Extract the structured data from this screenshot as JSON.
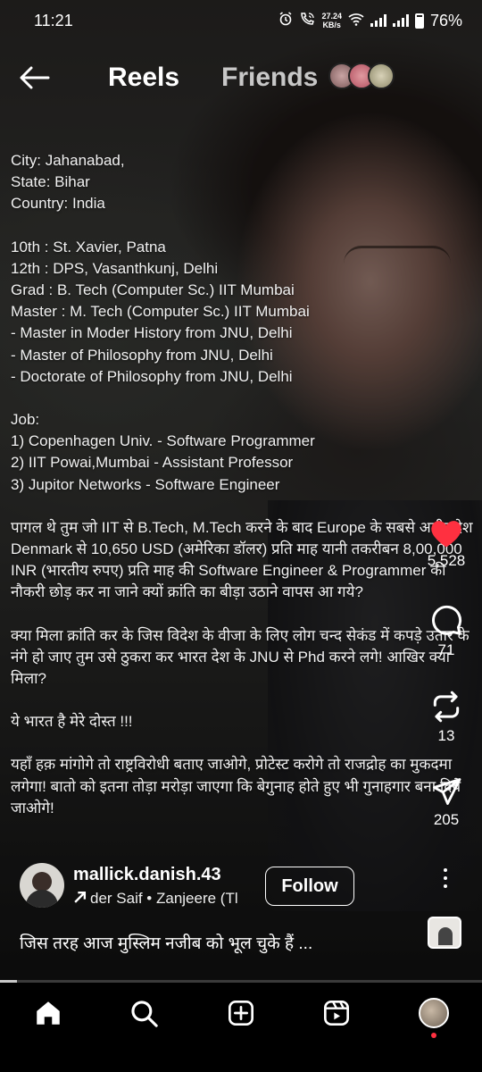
{
  "status_bar": {
    "time": "11:21",
    "net_speed_value": "27.24",
    "net_speed_unit": "KB/s",
    "battery": "76%",
    "icons": [
      "alarm-icon",
      "wifi-call-icon",
      "wifi-icon",
      "signal-icon",
      "signal-icon",
      "battery-icon"
    ]
  },
  "header": {
    "back_icon": "arrow-left-icon",
    "tab_reels": "Reels",
    "tab_friends": "Friends"
  },
  "overlay": {
    "location": [
      "City: Jahanabad,",
      "State: Bihar",
      "Country: India"
    ],
    "education": [
      "10th : St. Xavier, Patna",
      "12th : DPS, Vasanthkunj, Delhi",
      "Grad : B. Tech (Computer Sc.) IIT Mumbai",
      "Master : M. Tech (Computer Sc.) IIT Mumbai",
      "- Master in Moder History from JNU, Delhi",
      "- Master of Philosophy from JNU, Delhi",
      "- Doctorate of Philosophy from JNU, Delhi"
    ],
    "job_title": "Job:",
    "jobs": [
      "1) Copenhagen Univ. - Software Programmer",
      "2) IIT Powai,Mumbai - Assistant Professor",
      "3) Jupitor Networks - Software Engineer"
    ],
    "para1": "पागल थे तुम जो IIT से B.Tech, M.Tech करने के बाद Europe के सबसे अमीर देश Denmark से 10,650 USD (अमेरिका डॉलर) प्रति माह यानी तकरीबन 8,00,000 INR (भारतीय रुपए) प्रति माह की Software Engineer & Programmer की नौकरी छोड़ कर ना जाने क्यों क्रांति का बीड़ा उठाने वापस आ गये?",
    "para2": "क्या मिला क्रांति कर के जिस विदेश के वीजा के लिए लोग चन्द सेकंड में कपड़े उतार के नंगे हो जाए तुम उसे ठुकरा कर भारत देश के JNU से Phd करने लगे! आखिर क्या मिला?",
    "para3": "ये भारत है मेरे दोस्त !!!",
    "para4": "यहाँ हक़ मांगोगे तो राष्ट्रविरोधी बताए जाओगे, प्रोटेस्ट करोगे तो राजद्रोह का मुकदमा लगेगा! बातो को इतना तोड़ा मरोड़ा जाएगा कि बेगुनाह होते हुए भी गुनाहगार बना दिये जाओगे!"
  },
  "actions": {
    "likes": "5,528",
    "comments": "71",
    "reposts": "13",
    "shares": "205",
    "like_color": "#ff3040"
  },
  "post": {
    "username": "mallick.danish.43",
    "audio": "der Saif • Zanjeere (Tl",
    "follow_label": "Follow",
    "caption": "जिस तरह आज मुस्लिम नजीब को भूल चुके हैं ..."
  },
  "progress": {
    "fraction": 0.035
  },
  "nav": {
    "items": [
      "home-icon",
      "search-icon",
      "create-icon",
      "reels-icon",
      "profile-avatar"
    ]
  }
}
